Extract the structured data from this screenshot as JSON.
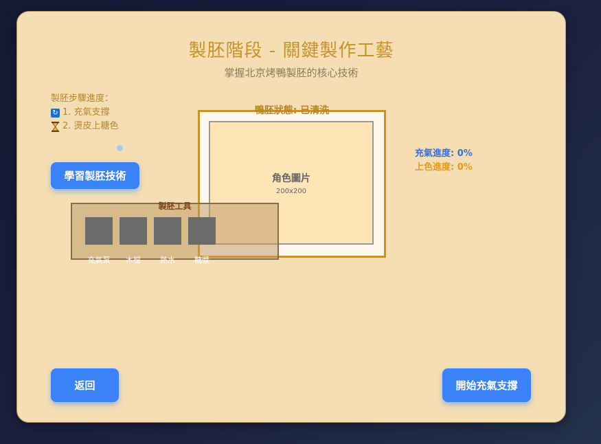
{
  "header": {
    "title": "製胚階段 - 關鍵製作工藝",
    "subtitle": "掌握北京烤鴨製胚的核心技術"
  },
  "progress": {
    "heading": "製胚步驟進度：",
    "steps": [
      {
        "icon": "refresh-icon",
        "label": "1. 充氣支撐"
      },
      {
        "icon": "hourglass-icon",
        "label": "2. 燙皮上糖色"
      }
    ]
  },
  "buttons": {
    "learn": "學習製胚技術",
    "back": "返回",
    "start": "開始充氣支撐"
  },
  "duck": {
    "status": "鴨胚狀態: 已清洗",
    "image_title": "角色圖片",
    "image_size": "200x200"
  },
  "stats": {
    "air": "充氣進度: 0%",
    "color": "上色進度: 0%"
  },
  "tools": {
    "title": "製胚工具",
    "items": [
      "充氣泵",
      "木棍",
      "熱水",
      "糖漿"
    ]
  },
  "colors": {
    "accent": "#3b82f6",
    "title": "#c8922a",
    "panel": "#f5deb3"
  }
}
